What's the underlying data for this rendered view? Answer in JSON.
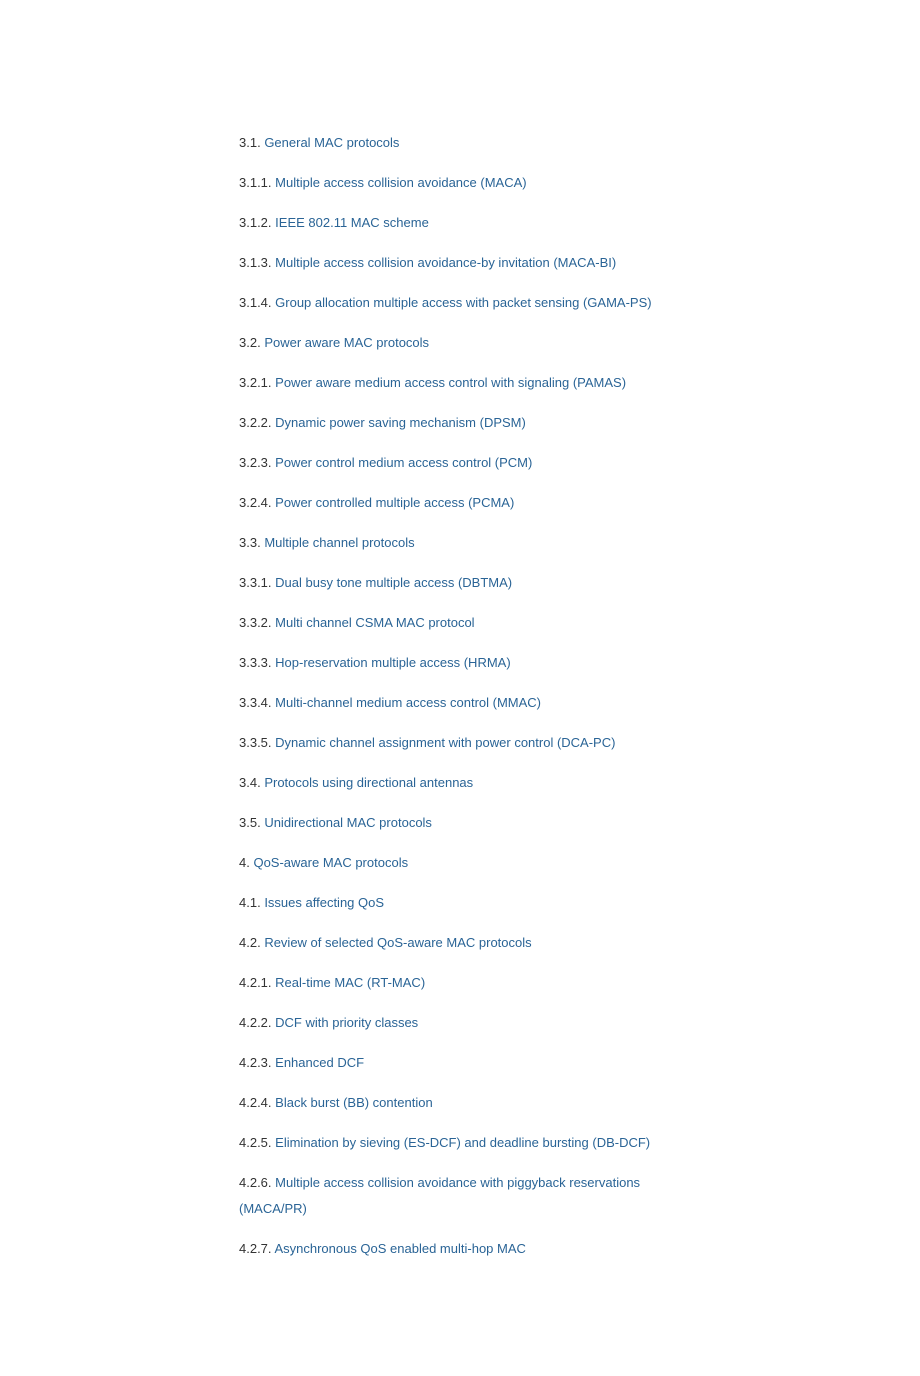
{
  "toc": [
    {
      "num": "3.1.",
      "title": "General MAC protocols"
    },
    {
      "num": "3.1.1.",
      "title": "Multiple access collision avoidance (MACA)"
    },
    {
      "num": "3.1.2.",
      "title": "IEEE 802.11 MAC scheme"
    },
    {
      "num": "3.1.3.",
      "title": "Multiple access collision avoidance-by invitation (MACA-BI)"
    },
    {
      "num": "3.1.4.",
      "title": "Group allocation multiple access with packet sensing (GAMA-PS)"
    },
    {
      "num": "3.2.",
      "title": "Power aware MAC protocols"
    },
    {
      "num": "3.2.1.",
      "title": "Power aware medium access control with signaling (PAMAS)"
    },
    {
      "num": "3.2.2.",
      "title": "Dynamic power saving mechanism (DPSM)"
    },
    {
      "num": "3.2.3.",
      "title": "Power control medium access control (PCM)"
    },
    {
      "num": "3.2.4.",
      "title": "Power controlled multiple access (PCMA)"
    },
    {
      "num": "3.3.",
      "title": "Multiple channel protocols"
    },
    {
      "num": "3.3.1.",
      "title": "Dual busy tone multiple access (DBTMA)"
    },
    {
      "num": "3.3.2.",
      "title": "Multi channel CSMA MAC protocol"
    },
    {
      "num": "3.3.3.",
      "title": "Hop-reservation multiple access (HRMA)"
    },
    {
      "num": "3.3.4.",
      "title": "Multi-channel medium access control (MMAC)"
    },
    {
      "num": "3.3.5.",
      "title": "Dynamic channel assignment with power control (DCA-PC)"
    },
    {
      "num": "3.4.",
      "title": "Protocols using directional antennas"
    },
    {
      "num": "3.5.",
      "title": "Unidirectional MAC protocols"
    },
    {
      "num": "4.",
      "title": "QoS-aware MAC protocols"
    },
    {
      "num": "4.1.",
      "title": "Issues affecting QoS"
    },
    {
      "num": "4.2.",
      "title": "Review of selected QoS-aware MAC protocols"
    },
    {
      "num": "4.2.1.",
      "title": "Real-time MAC (RT-MAC)"
    },
    {
      "num": "4.2.2.",
      "title": "DCF with priority classes"
    },
    {
      "num": "4.2.3.",
      "title": "Enhanced DCF"
    },
    {
      "num": "4.2.4.",
      "title": "Black burst (BB) contention"
    },
    {
      "num": "4.2.5.",
      "title": "Elimination by sieving (ES-DCF) and deadline bursting (DB-DCF)"
    },
    {
      "num": "4.2.6.",
      "title": "Multiple access collision avoidance with piggyback reservations (MACA/PR)"
    },
    {
      "num": "4.2.7.",
      "title": "Asynchronous QoS enabled multi-hop MAC"
    }
  ]
}
